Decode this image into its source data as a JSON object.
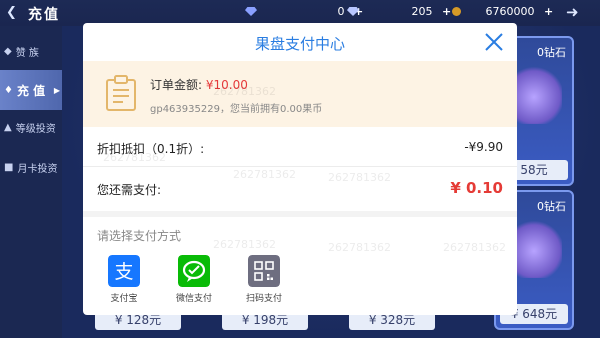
{
  "topbar": {
    "title": "充值",
    "resources": [
      {
        "icon": "diamond-icon",
        "value": "0",
        "plus": "+"
      },
      {
        "icon": "gem-icon",
        "value": "205",
        "plus": "+"
      },
      {
        "icon": "coin-icon",
        "value": "6760000",
        "plus": "+"
      }
    ]
  },
  "sidebar": {
    "items": [
      {
        "label": "赞 族",
        "icon": "crest-icon"
      },
      {
        "label": "充 值",
        "icon": "recharge-icon"
      },
      {
        "label": "等级投资",
        "icon": "level-invest-icon"
      },
      {
        "label": "月卡投资",
        "icon": "monthly-card-icon"
      }
    ]
  },
  "store": {
    "cards": [
      {
        "name": "0钻石",
        "price": "58元"
      },
      {
        "name": "0钻石",
        "price": "¥ 648元"
      }
    ],
    "bottom_prices": [
      "¥ 128元",
      "¥ 198元",
      "¥ 328元"
    ]
  },
  "modal": {
    "title": "果盘支付中心",
    "order_label": "订单金额:",
    "order_amount": "¥10.00",
    "order_sub": "gp463935229，您当前拥有0.00果币",
    "discount_label": "折扣抵扣（0.1折）:",
    "discount_value": "-¥9.90",
    "need_pay_label": "您还需支付:",
    "need_pay_value": "¥ 0.10",
    "method_title": "请选择支付方式",
    "methods": [
      {
        "label": "支付宝",
        "icon": "alipay-icon",
        "color": "#1677ff"
      },
      {
        "label": "微信支付",
        "icon": "wechat-pay-icon",
        "color": "#09bb07"
      },
      {
        "label": "扫码支付",
        "icon": "qr-code-icon",
        "color": "#6e6e80"
      }
    ],
    "watermark": "262781362"
  }
}
